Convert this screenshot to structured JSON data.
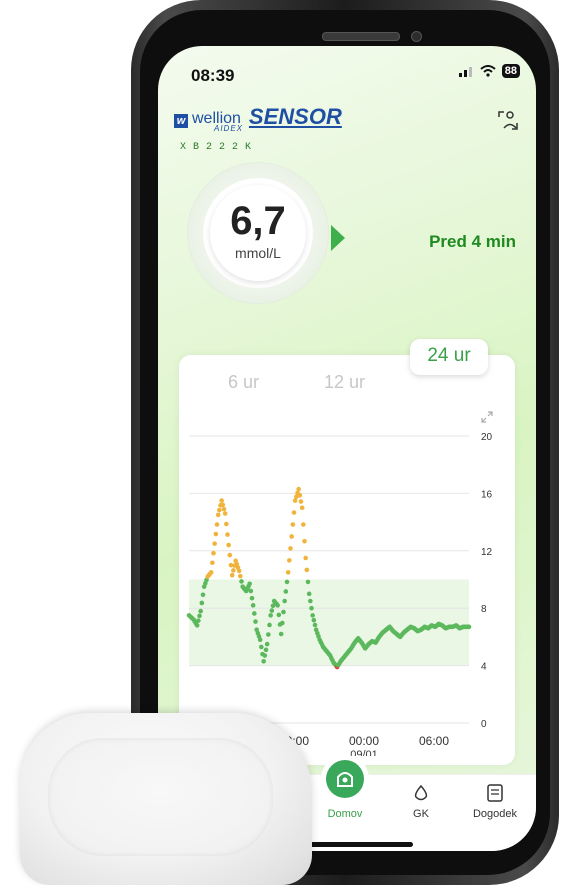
{
  "status_bar": {
    "time": "08:39",
    "battery": "88"
  },
  "header": {
    "brand": "wellion",
    "sub_brand": "AIDEX",
    "product": "SENSOR",
    "serial": "XB222K"
  },
  "glucose": {
    "value": "6,7",
    "unit": "mmol/L",
    "last_reading": "Pred 4 min",
    "trend": "rising"
  },
  "chart_tabs": {
    "tab_6": "6 ur",
    "tab_12": "12 ur",
    "tab_24": "24 ur",
    "active": "24 ur"
  },
  "chart_data": {
    "type": "scatter",
    "y_ticks": [
      "20",
      "16",
      "12",
      "8",
      "4",
      "0"
    ],
    "x_ticks": [
      "18:00",
      "00:00",
      "06:00"
    ],
    "x_tick_sub": "09/01",
    "ylim": [
      0,
      20
    ],
    "xlim_hours": [
      -24,
      0
    ],
    "target_range": [
      4,
      10
    ],
    "colors": {
      "in_range": "#5cb85c",
      "high": "#f0b43c",
      "low": "#e04040",
      "band": "#e9f7e4"
    },
    "series": [
      {
        "x": [
          -24,
          -23.6,
          -23.3,
          -23,
          -22.7,
          -22.4,
          -22.1,
          -21.8,
          -21.5,
          -21.2,
          -20.9,
          -20.6,
          -20.3,
          -20,
          -19.7,
          -19.4,
          -19.1,
          -18.8,
          -18.5,
          -18.2,
          -17.9,
          -17.6,
          -17.3,
          -17,
          -16.7,
          -16.4,
          -16.1,
          -15.8,
          -15.5,
          -15.2,
          -14.9,
          -14.6,
          -14.3,
          -14,
          -13.7,
          -13.4,
          -13.1,
          -12.8,
          -12.5,
          -12.2,
          -11.9,
          -11.6,
          -11.3,
          -11,
          -10.7,
          -10.4,
          -10.1,
          -9.8,
          -9.5,
          -9.2,
          -8.9,
          -8.6,
          -8.3,
          -8,
          -7.7,
          -7.4,
          -7.1,
          -6.8,
          -6.5,
          -6.2,
          -5.9,
          -5.6,
          -5.3,
          -5,
          -4.7,
          -4.4,
          -4.1,
          -3.8,
          -3.5,
          -3.2,
          -2.9,
          -2.6,
          -2.3,
          -2,
          -1.7,
          -1.4,
          -1.1,
          -0.8,
          -0.5,
          -0.2,
          0
        ],
        "y": [
          7.5,
          7.2,
          6.8,
          7.8,
          9.5,
          10.2,
          10.5,
          12.5,
          14.5,
          15.5,
          14.6,
          12.4,
          10.3,
          11.3,
          10.6,
          9.5,
          9.2,
          9.7,
          8.2,
          6.5,
          5.8,
          4.3,
          5.5,
          7.5,
          8.5,
          8.2,
          6.2,
          8.5,
          10.5,
          13.0,
          15.5,
          16.3,
          15.0,
          11.5,
          9.0,
          7.5,
          6.5,
          5.8,
          5.3,
          5.0,
          4.7,
          4.2,
          3.9,
          4.3,
          4.6,
          4.9,
          5.2,
          5.6,
          5.9,
          5.6,
          5.2,
          5.5,
          5.7,
          5.6,
          6.0,
          6.3,
          6.5,
          6.7,
          6.4,
          6.2,
          6.0,
          6.3,
          6.5,
          6.7,
          6.6,
          6.4,
          6.5,
          6.7,
          6.6,
          6.8,
          6.7,
          6.9,
          6.8,
          6.6,
          6.7,
          6.7,
          6.8,
          6.6,
          6.7,
          6.7,
          6.7
        ]
      }
    ]
  },
  "bottom_nav": {
    "home": "Domov",
    "gk": "GK",
    "event": "Dogodek"
  }
}
